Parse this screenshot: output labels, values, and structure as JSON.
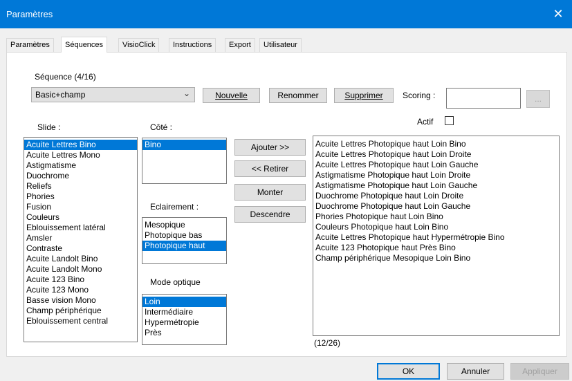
{
  "window": {
    "title": "Paramètres",
    "close_glyph": "✕"
  },
  "tabs": [
    {
      "label": "Paramètres"
    },
    {
      "label": "Séquences"
    },
    {
      "label": "VisioClick"
    },
    {
      "label": "Instructions"
    },
    {
      "label": "Export"
    },
    {
      "label": "Utilisateur"
    }
  ],
  "sequence": {
    "label": "Séquence (4/16)",
    "selected": "Basic+champ",
    "buttons": {
      "new": "Nouvelle",
      "rename": "Renommer",
      "delete": "Supprimer"
    },
    "scoring_label": "Scoring :",
    "scoring_value": "",
    "browse_label": "...",
    "active_label": "Actif",
    "active_checked": false
  },
  "slide": {
    "label": "Slide :",
    "items": [
      "Acuite Lettres Bino",
      "Acuite Lettres Mono",
      "Astigmatisme",
      "Duochrome",
      "Reliefs",
      "Phories",
      "Fusion",
      "Couleurs",
      "Eblouissement latéral",
      "Amsler",
      "Contraste",
      "Acuite Landolt Bino",
      "Acuite Landolt Mono",
      "Acuite 123 Bino",
      "Acuite 123 Mono",
      "Basse vision Mono",
      "Champ périphérique",
      "Eblouissement central"
    ],
    "selected_index": 0
  },
  "cote": {
    "label": "Côté :",
    "items": [
      "Bino"
    ],
    "selected_index": 0
  },
  "eclairement": {
    "label": "Eclairement :",
    "items": [
      "Mesopique",
      "Photopique bas",
      "Photopique haut"
    ],
    "selected_index": 2
  },
  "mode_optique": {
    "label": "Mode optique",
    "items": [
      "Loin",
      "Intermédiaire",
      "Hypermétropie",
      "Près"
    ],
    "selected_index": 0
  },
  "actions": {
    "add": "Ajouter >>",
    "remove": "<< Retirer",
    "up": "Monter",
    "down": "Descendre"
  },
  "steps": {
    "items": [
      "Acuite Lettres  Photopique haut  Loin  Bino",
      "Acuite Lettres  Photopique haut  Loin  Droite",
      "Acuite Lettres  Photopique haut  Loin  Gauche",
      "Astigmatisme  Photopique haut  Loin  Droite",
      "Astigmatisme  Photopique haut  Loin  Gauche",
      "Duochrome  Photopique haut  Loin  Droite",
      "Duochrome  Photopique haut  Loin  Gauche",
      "Phories  Photopique haut  Loin  Bino",
      "Couleurs  Photopique haut  Loin  Bino",
      "Acuite Lettres  Photopique haut  Hypermétropie  Bino",
      "Acuite 123  Photopique haut  Près  Bino",
      "Champ périphérique  Mesopique  Loin  Bino"
    ],
    "count_label": "(12/26)"
  },
  "footer": {
    "ok": "OK",
    "cancel": "Annuler",
    "apply": "Appliquer"
  },
  "colors": {
    "titlebar": "#0078d7",
    "selection": "#0078d7"
  }
}
